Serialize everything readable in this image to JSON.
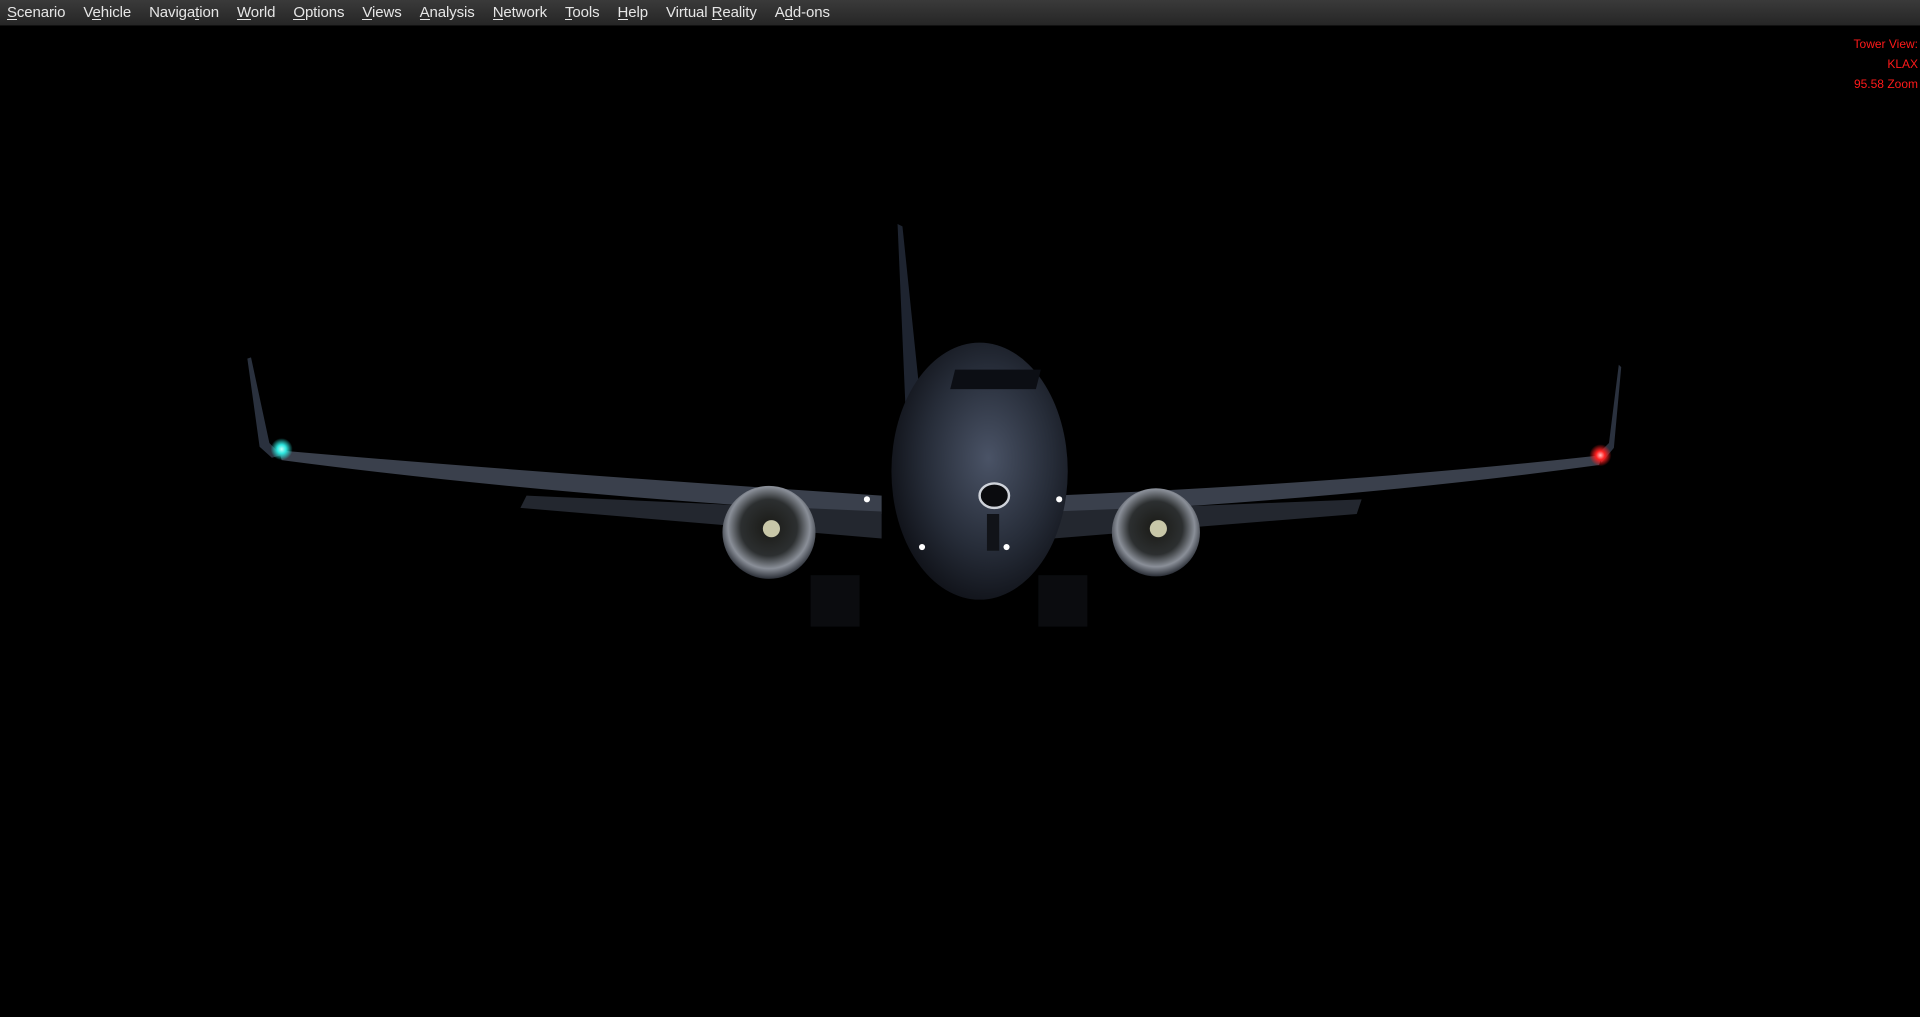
{
  "menu": {
    "items": [
      {
        "label": "Scenario",
        "accesskey_index": 0
      },
      {
        "label": "Vehicle",
        "accesskey_index": 1
      },
      {
        "label": "Navigation",
        "accesskey_index": 6
      },
      {
        "label": "World",
        "accesskey_index": 0
      },
      {
        "label": "Options",
        "accesskey_index": 0
      },
      {
        "label": "Views",
        "accesskey_index": 0
      },
      {
        "label": "Analysis",
        "accesskey_index": 0
      },
      {
        "label": "Network",
        "accesskey_index": 0
      },
      {
        "label": "Tools",
        "accesskey_index": 0
      },
      {
        "label": "Help",
        "accesskey_index": 0
      },
      {
        "label": "Virtual Reality",
        "accesskey_index": 8
      },
      {
        "label": "Add-ons",
        "accesskey_index": 1
      }
    ]
  },
  "hud": {
    "view_name": "Tower View:",
    "airport": "KLAX",
    "zoom": "95.58 Zoom",
    "color": "#ff1a1a"
  },
  "scene": {
    "subject": "airliner-approach-night",
    "nav_light_left_color": "#2ee8e0",
    "nav_light_right_color": "#ff2020"
  }
}
